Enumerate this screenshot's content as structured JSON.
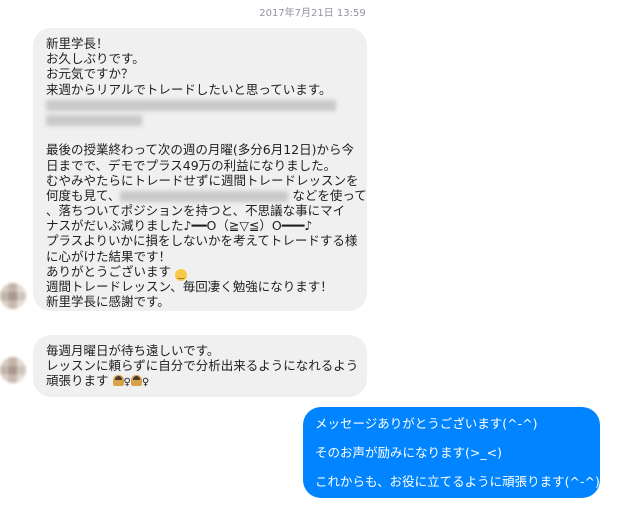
{
  "timestamp": "2017年7月21日 13:59",
  "messages_in": {
    "m1": {
      "l1": "新里学長！",
      "l2": "お久しぶりです。",
      "l3": "お元気ですか？",
      "l4": "来週からリアルでトレードしたいと思っています。",
      "l7": "最後の授業終わって次の週の月曜(多分6月12日)から今",
      "l8": "日までで、デモでプラス49万の利益になりました。",
      "l9": "むやみやたらにトレードせずに週間トレードレッスンを",
      "l10a": "何度も見て、",
      "l10b": "などを使って",
      "l11": "、落ちついてポジションを持つと、不思議な事にマイ",
      "l12": "ナスがだいぶ減りました♪━━O（≧▽≦）O━━━♪",
      "l13": "プラスよりいかに損をしないかを考えてトレードする様",
      "l14": "に心がけた結果です！",
      "l15": "ありがとうございます",
      "l16": "週間トレードレッスン、毎回凄く勉強になります！",
      "l17": "新里学長に感謝です。"
    },
    "m2": {
      "l1": "毎週月曜日が待ち遠しいです。",
      "l2": "レッスンに頼らずに自分で分析出来るようになれるよう",
      "l3": "頑張ります",
      "female_sign": "♀"
    }
  },
  "message_out": {
    "l1": "メッセージありがとうございます(^-^)",
    "l2": "そのお声が励みになります(>_<)",
    "l3": "これからも、お役に立てるように頑張ります(^-^)"
  },
  "icons": {
    "smile": "smiling-face-emoji",
    "bow": "person-bowing-emoji"
  },
  "colors": {
    "incoming_bubble": "#f1f0f0",
    "outgoing_bubble": "#0084ff",
    "timestamp_text": "#90949c"
  }
}
